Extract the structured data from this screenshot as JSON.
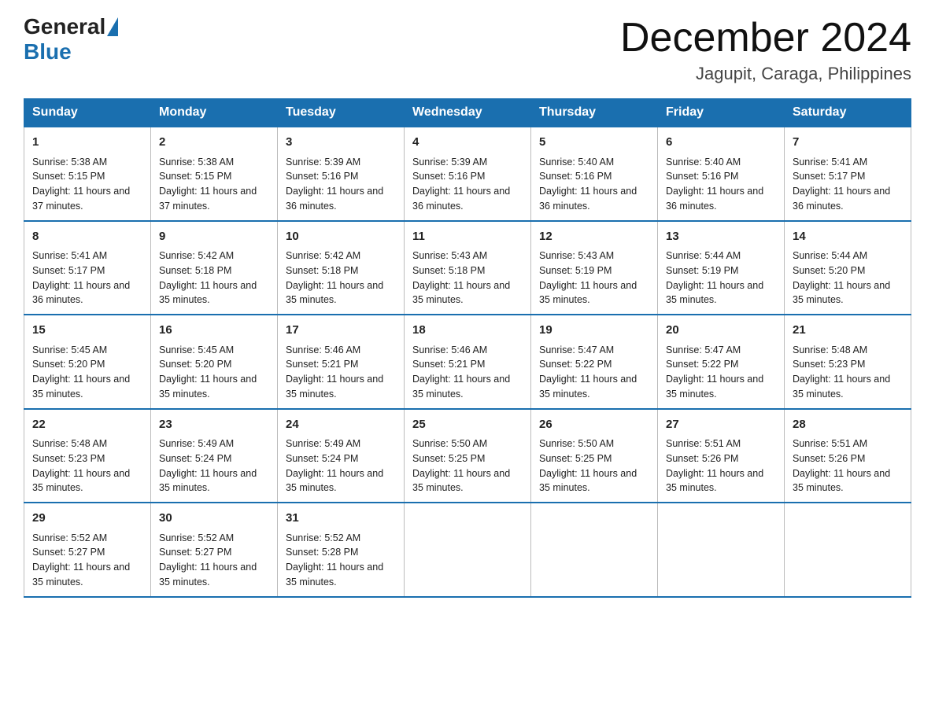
{
  "logo": {
    "general": "General",
    "blue": "Blue"
  },
  "title": {
    "month": "December 2024",
    "location": "Jagupit, Caraga, Philippines"
  },
  "days_of_week": [
    "Sunday",
    "Monday",
    "Tuesday",
    "Wednesday",
    "Thursday",
    "Friday",
    "Saturday"
  ],
  "weeks": [
    [
      {
        "day": "1",
        "sunrise": "5:38 AM",
        "sunset": "5:15 PM",
        "daylight": "11 hours and 37 minutes."
      },
      {
        "day": "2",
        "sunrise": "5:38 AM",
        "sunset": "5:15 PM",
        "daylight": "11 hours and 37 minutes."
      },
      {
        "day": "3",
        "sunrise": "5:39 AM",
        "sunset": "5:16 PM",
        "daylight": "11 hours and 36 minutes."
      },
      {
        "day": "4",
        "sunrise": "5:39 AM",
        "sunset": "5:16 PM",
        "daylight": "11 hours and 36 minutes."
      },
      {
        "day": "5",
        "sunrise": "5:40 AM",
        "sunset": "5:16 PM",
        "daylight": "11 hours and 36 minutes."
      },
      {
        "day": "6",
        "sunrise": "5:40 AM",
        "sunset": "5:16 PM",
        "daylight": "11 hours and 36 minutes."
      },
      {
        "day": "7",
        "sunrise": "5:41 AM",
        "sunset": "5:17 PM",
        "daylight": "11 hours and 36 minutes."
      }
    ],
    [
      {
        "day": "8",
        "sunrise": "5:41 AM",
        "sunset": "5:17 PM",
        "daylight": "11 hours and 36 minutes."
      },
      {
        "day": "9",
        "sunrise": "5:42 AM",
        "sunset": "5:18 PM",
        "daylight": "11 hours and 35 minutes."
      },
      {
        "day": "10",
        "sunrise": "5:42 AM",
        "sunset": "5:18 PM",
        "daylight": "11 hours and 35 minutes."
      },
      {
        "day": "11",
        "sunrise": "5:43 AM",
        "sunset": "5:18 PM",
        "daylight": "11 hours and 35 minutes."
      },
      {
        "day": "12",
        "sunrise": "5:43 AM",
        "sunset": "5:19 PM",
        "daylight": "11 hours and 35 minutes."
      },
      {
        "day": "13",
        "sunrise": "5:44 AM",
        "sunset": "5:19 PM",
        "daylight": "11 hours and 35 minutes."
      },
      {
        "day": "14",
        "sunrise": "5:44 AM",
        "sunset": "5:20 PM",
        "daylight": "11 hours and 35 minutes."
      }
    ],
    [
      {
        "day": "15",
        "sunrise": "5:45 AM",
        "sunset": "5:20 PM",
        "daylight": "11 hours and 35 minutes."
      },
      {
        "day": "16",
        "sunrise": "5:45 AM",
        "sunset": "5:20 PM",
        "daylight": "11 hours and 35 minutes."
      },
      {
        "day": "17",
        "sunrise": "5:46 AM",
        "sunset": "5:21 PM",
        "daylight": "11 hours and 35 minutes."
      },
      {
        "day": "18",
        "sunrise": "5:46 AM",
        "sunset": "5:21 PM",
        "daylight": "11 hours and 35 minutes."
      },
      {
        "day": "19",
        "sunrise": "5:47 AM",
        "sunset": "5:22 PM",
        "daylight": "11 hours and 35 minutes."
      },
      {
        "day": "20",
        "sunrise": "5:47 AM",
        "sunset": "5:22 PM",
        "daylight": "11 hours and 35 minutes."
      },
      {
        "day": "21",
        "sunrise": "5:48 AM",
        "sunset": "5:23 PM",
        "daylight": "11 hours and 35 minutes."
      }
    ],
    [
      {
        "day": "22",
        "sunrise": "5:48 AM",
        "sunset": "5:23 PM",
        "daylight": "11 hours and 35 minutes."
      },
      {
        "day": "23",
        "sunrise": "5:49 AM",
        "sunset": "5:24 PM",
        "daylight": "11 hours and 35 minutes."
      },
      {
        "day": "24",
        "sunrise": "5:49 AM",
        "sunset": "5:24 PM",
        "daylight": "11 hours and 35 minutes."
      },
      {
        "day": "25",
        "sunrise": "5:50 AM",
        "sunset": "5:25 PM",
        "daylight": "11 hours and 35 minutes."
      },
      {
        "day": "26",
        "sunrise": "5:50 AM",
        "sunset": "5:25 PM",
        "daylight": "11 hours and 35 minutes."
      },
      {
        "day": "27",
        "sunrise": "5:51 AM",
        "sunset": "5:26 PM",
        "daylight": "11 hours and 35 minutes."
      },
      {
        "day": "28",
        "sunrise": "5:51 AM",
        "sunset": "5:26 PM",
        "daylight": "11 hours and 35 minutes."
      }
    ],
    [
      {
        "day": "29",
        "sunrise": "5:52 AM",
        "sunset": "5:27 PM",
        "daylight": "11 hours and 35 minutes."
      },
      {
        "day": "30",
        "sunrise": "5:52 AM",
        "sunset": "5:27 PM",
        "daylight": "11 hours and 35 minutes."
      },
      {
        "day": "31",
        "sunrise": "5:52 AM",
        "sunset": "5:28 PM",
        "daylight": "11 hours and 35 minutes."
      },
      null,
      null,
      null,
      null
    ]
  ]
}
